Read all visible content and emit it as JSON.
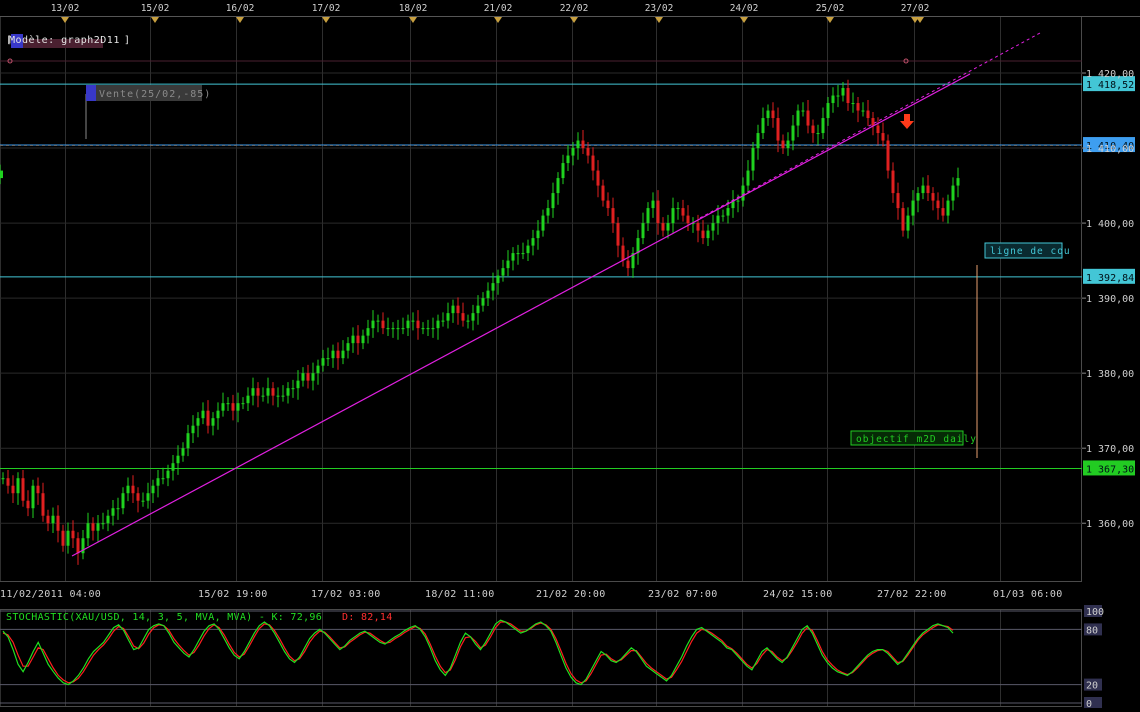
{
  "chart_data": [
    {
      "type": "candlestick",
      "title": "Modèle: graph2D11",
      "top_date_markers": [
        "13/02",
        "15/02",
        "16/02",
        "17/02",
        "18/02",
        "21/02",
        "22/02",
        "23/02",
        "24/02",
        "25/02",
        "27/02"
      ],
      "x_tick_labels": [
        "11/02/2011 04:00",
        "15/02 19:00",
        "17/02 03:00",
        "18/02 11:00",
        "21/02 20:00",
        "23/02 07:00",
        "24/02 15:00",
        "27/02 22:00",
        "01/03 06:00"
      ],
      "y_ticks": [
        "1 420,00",
        "1 410,00",
        "1 400,00",
        "1 390,00",
        "1 380,00",
        "1 370,00",
        "1 360,00"
      ],
      "y_tick_values": [
        1420,
        1410,
        1400,
        1390,
        1380,
        1370,
        1360
      ],
      "ylim": [
        1352.3,
        1427.6
      ],
      "price_levels": [
        {
          "value": 1418.52,
          "label": "1 418,52",
          "color": "#43c6d6"
        },
        {
          "value": 1410.4,
          "label": "1 410,40",
          "color": "#3e9ef0"
        },
        {
          "value": 1392.84,
          "label": "1 392,84",
          "color": "#43c6d6"
        },
        {
          "value": 1367.3,
          "label": "1 367,30",
          "color": "#22cc22"
        }
      ],
      "annotations": [
        {
          "text": "Vente(25/02,-85)",
          "type": "flag"
        },
        {
          "text": "ligne de cou",
          "type": "label"
        },
        {
          "text": "objectif m2D daily",
          "type": "label"
        }
      ],
      "series": [
        {
          "kind": "ohlc-close-path",
          "x": [
            0,
            5,
            10,
            15,
            20,
            25,
            30,
            35,
            40,
            45,
            50,
            55,
            60,
            65,
            70,
            75,
            80,
            85,
            90,
            95,
            100,
            105,
            110,
            115,
            120,
            125,
            130,
            135,
            140,
            145,
            150,
            155,
            160,
            165,
            170,
            175,
            180,
            185,
            190,
            195,
            200,
            205,
            210,
            215,
            220,
            225,
            230,
            235,
            240,
            245,
            250,
            255,
            260,
            265,
            270,
            275,
            280,
            285,
            290,
            295,
            300,
            305,
            310,
            315,
            320,
            325,
            330,
            335,
            340,
            345,
            350,
            355,
            360,
            365,
            370,
            375,
            380,
            385,
            390,
            395,
            400,
            405,
            410,
            415,
            420,
            425,
            430,
            435,
            440,
            445,
            450,
            455,
            460,
            465,
            470,
            475,
            480,
            485,
            490,
            495,
            500,
            505,
            510,
            515,
            520,
            525,
            530,
            535,
            540,
            545,
            550,
            555,
            560,
            565,
            570,
            575,
            580,
            585,
            590,
            595,
            600,
            605,
            610,
            615,
            620,
            625,
            630,
            635,
            640,
            645,
            650,
            655,
            660,
            665,
            670,
            675,
            680,
            685,
            690,
            695,
            700,
            705,
            710,
            715,
            720,
            725,
            730,
            735,
            740,
            745,
            750,
            755,
            760,
            765,
            770,
            775,
            780,
            785,
            790,
            795,
            800,
            805,
            810,
            815,
            820,
            825,
            830,
            835,
            840,
            845,
            850,
            855,
            860,
            865,
            870,
            875,
            880,
            885,
            890,
            895,
            900,
            905,
            910,
            915,
            920,
            925,
            930,
            935,
            940,
            945,
            950,
            955
          ],
          "close": [
            1366,
            1365,
            1364,
            1366,
            1363,
            1362,
            1365,
            1364,
            1361,
            1360,
            1361,
            1359,
            1357,
            1359,
            1358,
            1356,
            1358,
            1360,
            1359,
            1360,
            1360,
            1361,
            1362,
            1362,
            1364,
            1365,
            1364,
            1363,
            1363,
            1364,
            1365,
            1366,
            1366,
            1367,
            1368,
            1369,
            1370,
            1372,
            1373,
            1374,
            1375,
            1373,
            1374,
            1375,
            1376,
            1376,
            1375,
            1376,
            1376,
            1377,
            1378,
            1377,
            1377,
            1378,
            1377,
            1377,
            1377,
            1378,
            1378,
            1379,
            1380,
            1379,
            1380,
            1381,
            1382,
            1382,
            1383,
            1382,
            1383,
            1384,
            1385,
            1384,
            1385,
            1386,
            1387,
            1387,
            1386,
            1386,
            1386,
            1386,
            1386,
            1387,
            1387,
            1386,
            1386,
            1386,
            1386,
            1387,
            1387,
            1388,
            1389,
            1388,
            1387,
            1387,
            1388,
            1389,
            1390,
            1391,
            1392,
            1393,
            1394,
            1395,
            1396,
            1396,
            1396,
            1397,
            1398,
            1399,
            1401,
            1402,
            1404,
            1406,
            1408,
            1409,
            1410,
            1411,
            1410,
            1409,
            1407,
            1405,
            1403,
            1402,
            1400,
            1397,
            1395,
            1394,
            1396,
            1398,
            1400,
            1402,
            1403,
            1400,
            1399,
            1400,
            1402,
            1402,
            1401,
            1400,
            1400,
            1399,
            1398,
            1399,
            1400,
            1401,
            1401,
            1402,
            1403,
            1403,
            1405,
            1407,
            1410,
            1412,
            1414,
            1415,
            1414,
            1411,
            1410,
            1411,
            1413,
            1415,
            1415,
            1413,
            1412,
            1412,
            1414,
            1416,
            1417,
            1417,
            1418,
            1416,
            1416,
            1415,
            1415,
            1414,
            1413,
            1412,
            1411,
            1407,
            1404,
            1402,
            1399,
            1401,
            1403,
            1404,
            1405,
            1404,
            1403,
            1402,
            1401,
            1403,
            1405,
            1406,
            1407
          ]
        }
      ]
    },
    {
      "type": "line",
      "title": "STOCHASTIC(XAU/USD, 14, 3, 5, MVA, MVA) - K: 72,96",
      "d_label": "D: 82,14",
      "ylim": [
        0,
        100
      ],
      "y_ticks": [
        "100",
        "80",
        "20",
        "0"
      ],
      "y_tick_values": [
        100,
        80,
        20,
        0
      ],
      "k_values": [
        78,
        72,
        58,
        42,
        34,
        44,
        56,
        66,
        54,
        42,
        34,
        27,
        22,
        20,
        24,
        30,
        38,
        48,
        56,
        61,
        66,
        74,
        82,
        85,
        79,
        68,
        58,
        60,
        70,
        80,
        84,
        86,
        84,
        76,
        66,
        60,
        54,
        50,
        58,
        68,
        78,
        84,
        86,
        80,
        70,
        60,
        52,
        48,
        56,
        66,
        76,
        84,
        88,
        84,
        76,
        66,
        56,
        48,
        44,
        50,
        60,
        70,
        76,
        80,
        76,
        70,
        64,
        58,
        62,
        68,
        72,
        76,
        78,
        74,
        70,
        66,
        64,
        68,
        72,
        75,
        79,
        82,
        84,
        80,
        72,
        60,
        46,
        36,
        30,
        38,
        52,
        66,
        76,
        72,
        64,
        58,
        66,
        76,
        86,
        90,
        88,
        84,
        80,
        76,
        78,
        82,
        86,
        88,
        84,
        78,
        66,
        52,
        38,
        28,
        22,
        20,
        26,
        36,
        46,
        56,
        52,
        46,
        44,
        48,
        54,
        60,
        56,
        48,
        40,
        36,
        32,
        28,
        24,
        30,
        40,
        50,
        62,
        72,
        80,
        82,
        78,
        74,
        70,
        66,
        60,
        58,
        52,
        46,
        40,
        36,
        46,
        56,
        60,
        54,
        48,
        44,
        50,
        60,
        70,
        80,
        84,
        76,
        64,
        52,
        44,
        38,
        34,
        32,
        30,
        34,
        40,
        46,
        52,
        56,
        58,
        58,
        54,
        48,
        42,
        46,
        54,
        62,
        70,
        76,
        80,
        84,
        86,
        84,
        82,
        76
      ],
      "d_values": [
        76,
        74,
        66,
        52,
        40,
        40,
        50,
        60,
        58,
        48,
        38,
        30,
        25,
        22,
        23,
        27,
        34,
        43,
        52,
        58,
        63,
        70,
        78,
        83,
        81,
        72,
        62,
        59,
        65,
        75,
        82,
        85,
        84,
        79,
        70,
        63,
        57,
        52,
        55,
        63,
        73,
        81,
        85,
        82,
        74,
        64,
        55,
        50,
        53,
        62,
        72,
        81,
        86,
        85,
        79,
        70,
        60,
        51,
        46,
        48,
        56,
        66,
        73,
        78,
        77,
        72,
        66,
        60,
        61,
        66,
        70,
        74,
        77,
        76,
        72,
        68,
        65,
        66,
        70,
        73,
        77,
        80,
        83,
        81,
        75,
        64,
        51,
        40,
        33,
        36,
        47,
        61,
        71,
        72,
        67,
        60,
        63,
        72,
        82,
        88,
        88,
        86,
        82,
        78,
        78,
        81,
        85,
        87,
        85,
        80,
        70,
        57,
        43,
        32,
        25,
        22,
        24,
        32,
        42,
        52,
        53,
        48,
        45,
        47,
        52,
        57,
        57,
        50,
        43,
        38,
        34,
        30,
        26,
        28,
        36,
        45,
        56,
        67,
        76,
        80,
        79,
        76,
        72,
        68,
        62,
        59,
        54,
        48,
        42,
        38,
        43,
        52,
        58,
        56,
        50,
        46,
        49,
        57,
        66,
        76,
        82,
        79,
        68,
        56,
        47,
        41,
        36,
        33,
        31,
        33,
        38,
        44,
        50,
        54,
        57,
        58,
        56,
        50,
        44,
        45,
        52,
        60,
        68,
        74,
        78,
        82,
        85,
        84,
        83,
        79
      ]
    }
  ]
}
